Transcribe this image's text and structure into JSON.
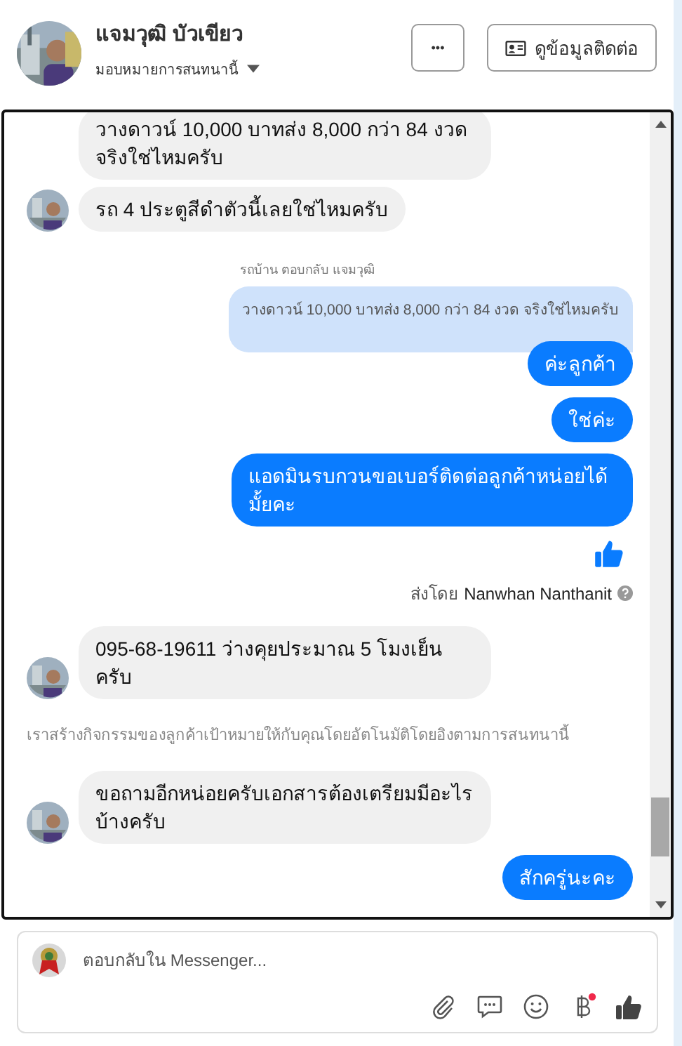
{
  "header": {
    "name": "แจมวุฒิ บัวเขียว",
    "assign": "มอบหมายการสนทนานี้",
    "more_button": "•••",
    "contact_button": "ดูข้อมูลติดต่อ"
  },
  "messages": [
    {
      "kind": "incoming",
      "text": "วางดาวน์ 10,000 บาทส่ง 8,000 กว่า 84 งวด จริงใช่ไหมครับ",
      "avatar": false
    },
    {
      "kind": "incoming",
      "text": "รถ 4 ประตูสีดำตัวนี้เลยใช่ไหมครับ",
      "avatar": true
    },
    {
      "kind": "reply-label",
      "text": "รถบ้าน ตอบกลับ แจมวุฒิ"
    },
    {
      "kind": "quote",
      "text": "วางดาวน์ 10,000 บาทส่ง 8,000 กว่า 84 งวด จริงใช่ไหมครับ"
    },
    {
      "kind": "outgoing",
      "text": "ค่ะลูกค้า"
    },
    {
      "kind": "outgoing",
      "text": "ใช่ค่ะ"
    },
    {
      "kind": "outgoing",
      "text": "แอดมินรบกวนขอเบอร์ติดต่อลูกค้าหน่อยได้มั้ยคะ"
    },
    {
      "kind": "like"
    },
    {
      "kind": "sent-by",
      "prefix": "ส่งโดย",
      "name": "Nanwhan Nanthanit"
    },
    {
      "kind": "incoming",
      "text": "095-68-19611 ว่างคุยประมาณ 5 โมงเย็นครับ",
      "avatar": true
    },
    {
      "kind": "notice",
      "text": "เราสร้างกิจกรรมของลูกค้าเป้าหมายให้กับคุณโดยอัตโนมัติโดยอิงตามการสนทนานี้"
    },
    {
      "kind": "incoming",
      "text": "ขอถามอีกหน่อยครับเอกสารต้องเตรียมมีอะไรบ้างครับ",
      "avatar": true
    },
    {
      "kind": "outgoing",
      "text": "สักครู่นะคะ"
    }
  ],
  "composer": {
    "placeholder": "ตอบกลับใน Messenger..."
  }
}
